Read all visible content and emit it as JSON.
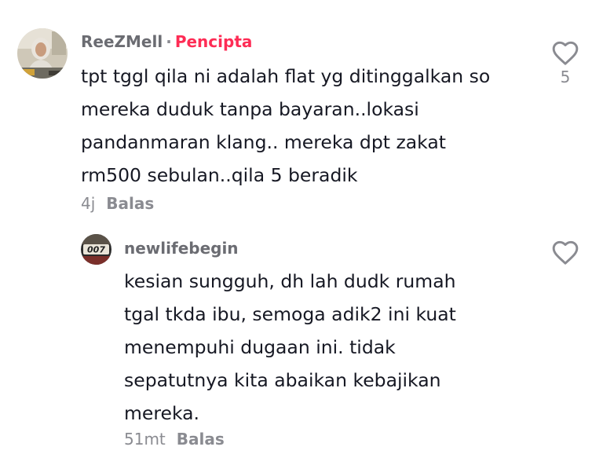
{
  "comments": [
    {
      "username": "ReeZMell",
      "separator": "·",
      "badge": "Pencipta",
      "lines": [
        "tpt tggl qila ni adalah flat yg ditinggalkan so",
        "mereka duduk tanpa bayaran..lokasi",
        "pandanmaran klang.. mereka dpt zakat",
        "rm500 sebulan..qila 5 beradik"
      ],
      "time": "4j",
      "reply_label": "Balas",
      "like_count": "5",
      "like_icon": "heart-outline-icon"
    },
    {
      "username": "newlifebegin",
      "lines": [
        "kesian sungguh, dh lah dudk rumah",
        "tgal tkda ibu, semoga adik2 ini kuat",
        "menempuhi dugaan ini. tidak",
        "sepatutnya kita abaikan kebajikan",
        "mereka."
      ],
      "time": "51mt",
      "reply_label": "Balas",
      "like_icon": "heart-outline-icon"
    }
  ],
  "colors": {
    "text": "#161823",
    "username": "#6b6c72",
    "meta": "#8a8b91",
    "creator_badge": "#fe2c55"
  }
}
